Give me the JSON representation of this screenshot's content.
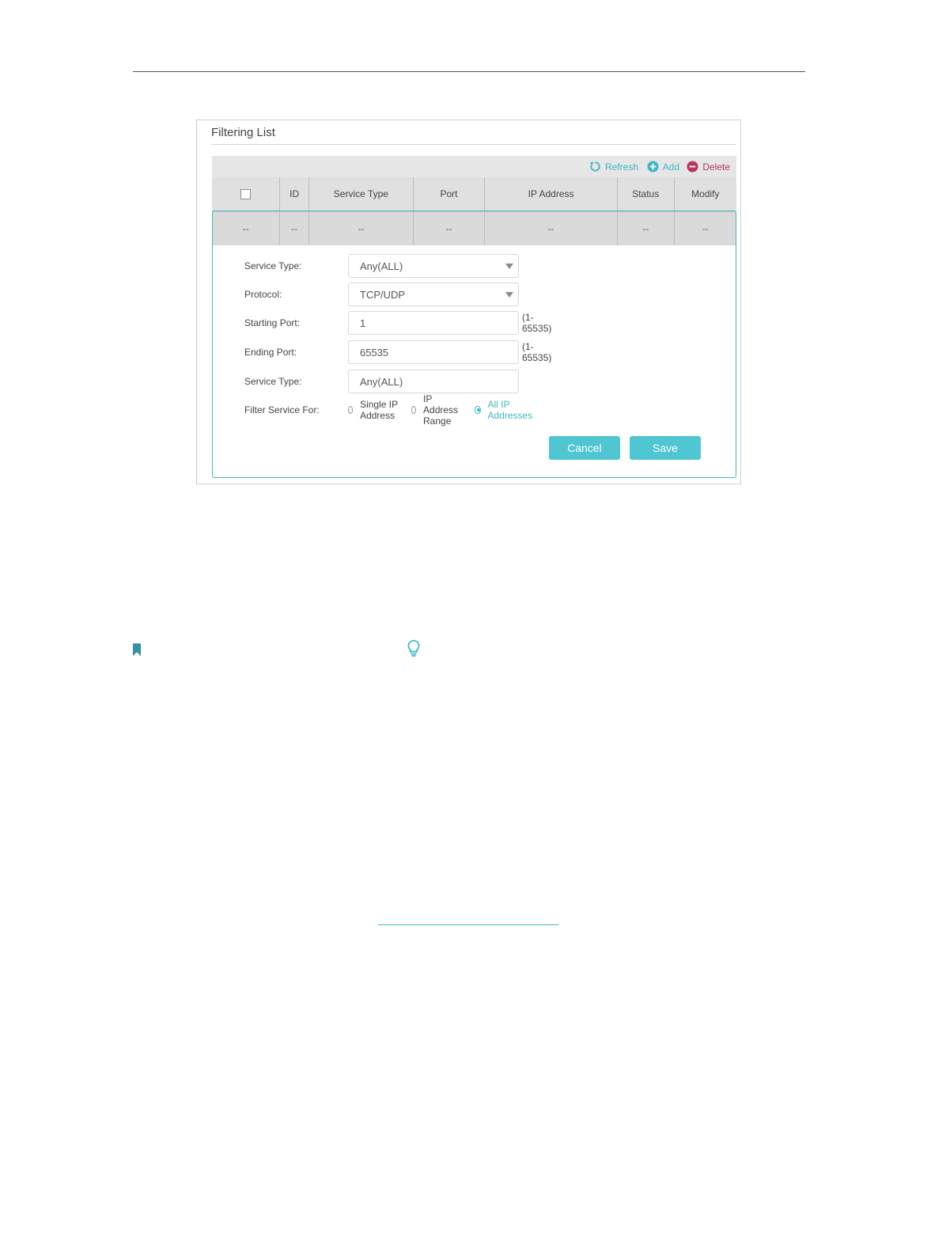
{
  "panel": {
    "title": "Filtering List"
  },
  "toolbar": {
    "refresh_label": "Refresh",
    "add_label": "Add",
    "delete_label": "Delete"
  },
  "table": {
    "columns": [
      "ID",
      "Service Type",
      "Port",
      "IP Address",
      "Status",
      "Modify"
    ],
    "row": [
      "--",
      "--",
      "--",
      "--",
      "--",
      "--",
      "--"
    ]
  },
  "form": {
    "service_type_label": "Service Type:",
    "service_type_value": "Any(ALL)",
    "protocol_label": "Protocol:",
    "protocol_value": "TCP/UDP",
    "starting_port_label": "Starting Port:",
    "starting_port_value": "1",
    "ending_port_label": "Ending Port:",
    "ending_port_value": "65535",
    "port_hint": "(1-65535)",
    "service_type2_label": "Service Type:",
    "service_type2_value": "Any(ALL)",
    "filter_for_label": "Filter Service For:",
    "radio_options": [
      "Single IP Address",
      "IP Address Range",
      "All IP Addresses"
    ],
    "radio_selected": "All IP Addresses",
    "cancel_label": "Cancel",
    "save_label": "Save"
  },
  "colors": {
    "accent": "#4fc6d2",
    "delete": "#b8365e"
  }
}
